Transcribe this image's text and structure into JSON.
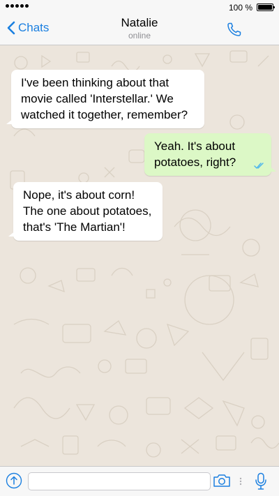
{
  "status_bar": {
    "battery_text": "100 %",
    "signal_dots": 5
  },
  "nav": {
    "back_label": "Chats",
    "contact_name": "Natalie",
    "contact_status": "online",
    "back_icon": "chevron-left-icon",
    "call_icon": "phone-icon"
  },
  "colors": {
    "accent": "#1a7fe0",
    "chat_background": "#ece5dc",
    "incoming_bubble": "#ffffff",
    "outgoing_bubble": "#dcf8c6",
    "read_ticks": "#4fb6ec"
  },
  "messages": [
    {
      "direction": "incoming",
      "lines": [
        "I've been thinking about that",
        "movie called 'Interstellar.' We",
        "watched it together, remember?"
      ]
    },
    {
      "direction": "outgoing",
      "lines": [
        "Yeah. It's about",
        "potatoes, right?"
      ],
      "status_icon": "double-check-icon"
    },
    {
      "direction": "incoming",
      "lines": [
        "Nope, it's about corn!",
        "The one about potatoes,",
        "that's 'The Martian'!"
      ]
    }
  ],
  "input_bar": {
    "share_icon": "share-up-arrow-icon",
    "message_value": "",
    "camera_icon": "camera-icon",
    "mic_icon": "microphone-icon"
  }
}
